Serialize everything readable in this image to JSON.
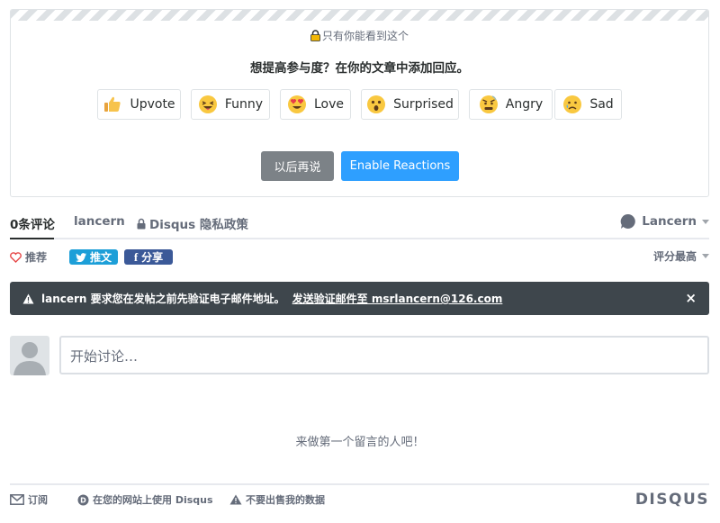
{
  "promo": {
    "private_note": "只有你能看到这个",
    "title": "想提高参与度？在你的文章中添加回应。",
    "reactions": [
      {
        "label": "Upvote",
        "icon": "thumbs-up-icon"
      },
      {
        "label": "Funny",
        "icon": "funny-face-icon"
      },
      {
        "label": "Love",
        "icon": "heart-eyes-icon"
      },
      {
        "label": "Surprised",
        "icon": "surprised-face-icon"
      },
      {
        "label": "Angry",
        "icon": "angry-face-icon"
      },
      {
        "label": "Sad",
        "icon": "sad-face-icon"
      }
    ],
    "later_label": "以后再说",
    "enable_label": "Enable Reactions"
  },
  "tabs": {
    "comments": "0条评论",
    "community": "lancern",
    "privacy": "Disqus 隐私政策",
    "user": "Lancern"
  },
  "actions": {
    "recommend": "推荐",
    "tweet": "推文",
    "share": "分享",
    "sort": "评分最高"
  },
  "alert": {
    "message": "lancern 要求您在发帖之前先验证电子邮件地址。",
    "link": "发送验证邮件至 msrlancern@126.com",
    "close": "×"
  },
  "composer": {
    "placeholder": "开始讨论…"
  },
  "empty_state": "来做第一个留言的人吧！",
  "footer": {
    "subscribe": "订阅",
    "use_disqus": "在您的网站上使用 Disqus",
    "do_not_sell": "不要出售我的数据",
    "logo": "DISQUS"
  },
  "colors": {
    "accent_blue": "#2e9fff",
    "twitter_blue": "#1d9fd8",
    "facebook_blue": "#3b5998",
    "alert_bg": "#3e464c",
    "heart_red": "#e64a4a"
  }
}
